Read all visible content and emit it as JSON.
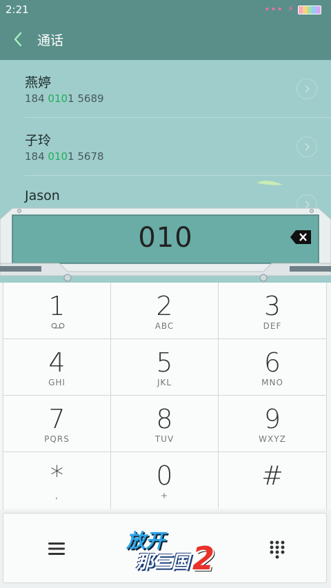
{
  "status_bar": {
    "time": "2:21"
  },
  "header": {
    "title": "通话"
  },
  "contacts": [
    {
      "name": "燕婷",
      "number_pre": "184 ",
      "number_match": "010",
      "number_post": "1 5689"
    },
    {
      "name": "子玲",
      "number_pre": "184 ",
      "number_match": "010",
      "number_post": "1 5678"
    },
    {
      "name": "Jason"
    }
  ],
  "dialer": {
    "display_number": "010"
  },
  "keypad": [
    {
      "digit": "1",
      "letters": ""
    },
    {
      "digit": "2",
      "letters": "ABC"
    },
    {
      "digit": "3",
      "letters": "DEF"
    },
    {
      "digit": "4",
      "letters": "GHI"
    },
    {
      "digit": "5",
      "letters": "JKL"
    },
    {
      "digit": "6",
      "letters": "MNO"
    },
    {
      "digit": "7",
      "letters": "PQRS"
    },
    {
      "digit": "8",
      "letters": "TUV"
    },
    {
      "digit": "9",
      "letters": "WXYZ"
    },
    {
      "digit": "*",
      "letters": ","
    },
    {
      "digit": "0",
      "letters": "+"
    },
    {
      "digit": "#",
      "letters": ""
    }
  ],
  "bottom_bar": {
    "logo_line1": "放开",
    "logo_line2": "那三国",
    "logo_number": "2"
  },
  "colors": {
    "header_bg": "#5a8f89",
    "list_bg": "#9fcdcb",
    "match_highlight": "#1fae5a",
    "back_icon": "#a7f0c0"
  },
  "icons": [
    "back-chevron-icon",
    "chevron-right-icon",
    "backspace-icon",
    "voicemail-icon",
    "menu-icon",
    "dialpad-icon",
    "leaf-icon"
  ]
}
